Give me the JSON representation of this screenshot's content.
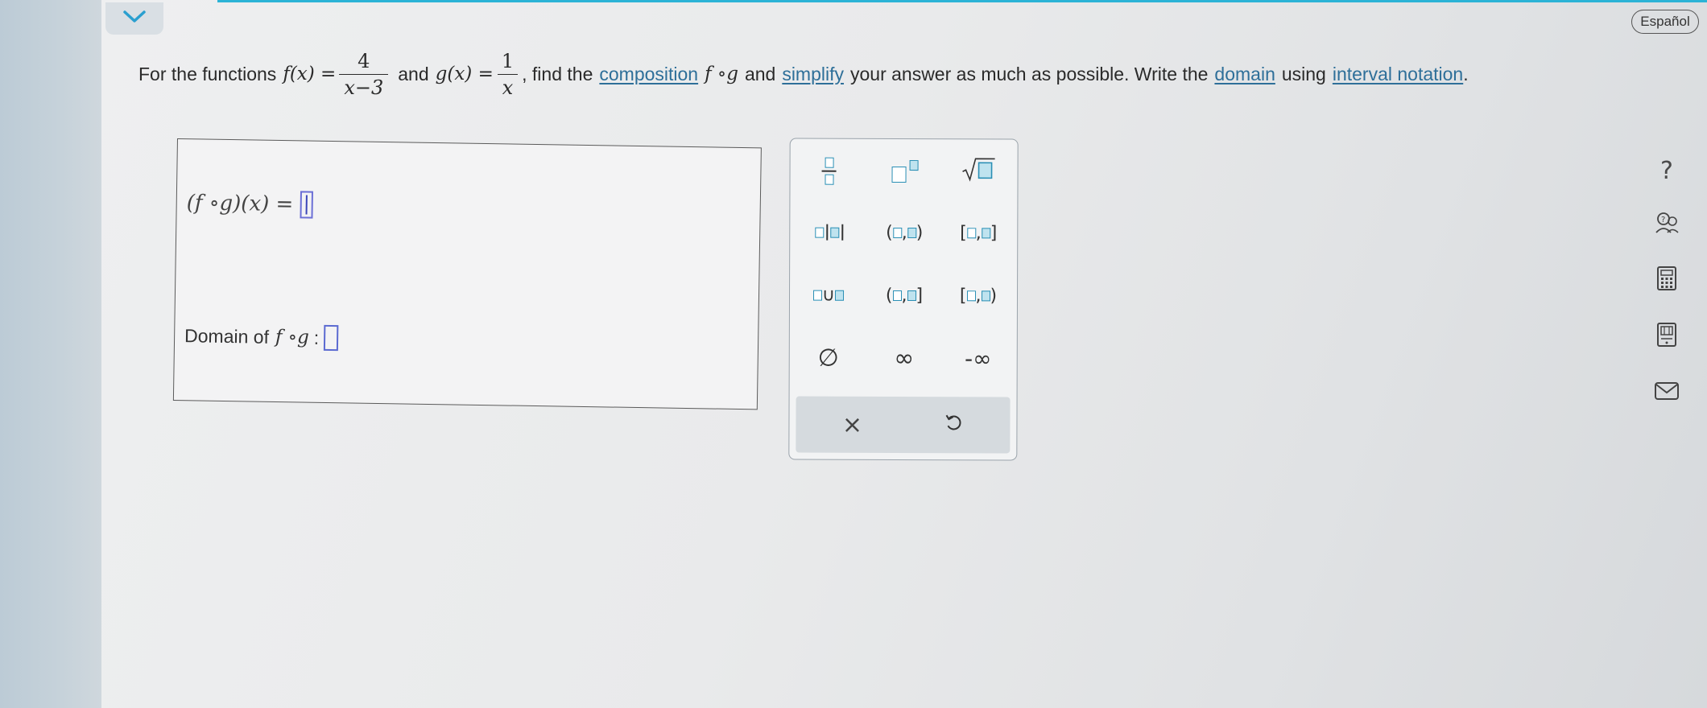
{
  "header": {
    "collapse_icon": "chevron-down-icon",
    "language_button": "Español",
    "accent_color": "#2bb3d6"
  },
  "question": {
    "text_1": "For the functions",
    "f_def": "f(x) =",
    "f_numerator": "4",
    "f_denominator": "x−3",
    "text_and": "and",
    "g_def": "g(x) =",
    "g_numerator": "1",
    "g_denominator": "x",
    "text_find": ", find the",
    "link_composition": "composition",
    "comp_symbol": "f ∘g",
    "text_and2": "and",
    "link_simplify": "simplify",
    "text_rest": "your answer as much as possible. Write the",
    "link_domain": "domain",
    "text_using": "using",
    "link_interval": "interval notation",
    "text_end": ".",
    "link_color": "#2e6f99"
  },
  "answer": {
    "composition_label": "(f ∘g)(x) =",
    "domain_label": "Domain of",
    "domain_symbol": "f ∘g",
    "domain_colon": ":"
  },
  "keypad": {
    "keys": [
      {
        "name": "fraction",
        "icon": "fraction-icon"
      },
      {
        "name": "exponent",
        "icon": "superscript-icon"
      },
      {
        "name": "square-root",
        "icon": "sqrt-icon"
      },
      {
        "name": "absolute-value",
        "icon": "absolute-value-icon"
      },
      {
        "name": "open-interval",
        "label": "(□,□)"
      },
      {
        "name": "closed-interval",
        "label": "[□,□]"
      },
      {
        "name": "union",
        "label": "□∪□"
      },
      {
        "name": "left-open-interval",
        "label": "(□,□]"
      },
      {
        "name": "right-open-interval",
        "label": "[□,□)"
      },
      {
        "name": "empty-set",
        "label": "∅"
      },
      {
        "name": "infinity",
        "label": "∞"
      },
      {
        "name": "negative-infinity",
        "label": "-∞"
      }
    ],
    "clear_label": "×",
    "undo_icon": "undo-icon"
  },
  "side_tools": [
    {
      "name": "help",
      "icon": "question-icon",
      "label": "?"
    },
    {
      "name": "ask-instructor",
      "icon": "person-question-icon"
    },
    {
      "name": "calculator",
      "icon": "calculator-icon"
    },
    {
      "name": "textbook",
      "icon": "textbook-icon"
    },
    {
      "name": "message",
      "icon": "mail-icon"
    }
  ]
}
